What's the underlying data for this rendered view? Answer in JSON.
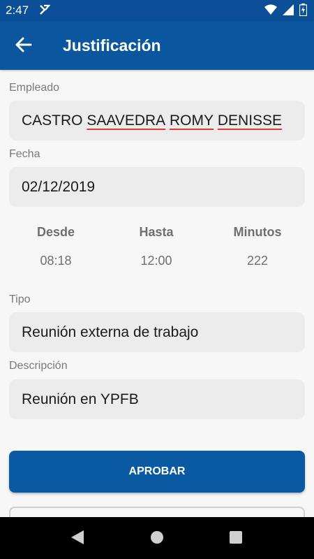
{
  "status_bar": {
    "time": "2:47"
  },
  "app_bar": {
    "title": "Justificación"
  },
  "form": {
    "empleado": {
      "label": "Empleado",
      "value_prefix": "CASTRO ",
      "value_w1": "SAAVEDRA",
      "value_w2": "ROMY",
      "value_w3": "DENISSE"
    },
    "fecha": {
      "label": "Fecha",
      "value": "02/12/2019"
    },
    "horario": {
      "desde": {
        "label": "Desde",
        "value": "08:18"
      },
      "hasta": {
        "label": "Hasta",
        "value": "12:00"
      },
      "minutos": {
        "label": "Minutos",
        "value": "222"
      }
    },
    "tipo": {
      "label": "Tipo",
      "value": "Reunión externa de trabajo"
    },
    "descripcion": {
      "label": "Descripción",
      "value": "Reunión en YPFB"
    }
  },
  "actions": {
    "aprobar_label": "APROBAR"
  },
  "colors": {
    "primary": "#0a579f",
    "status_bar": "#0a4f97",
    "field_bg": "#ececec",
    "spell_underline": "#e53935"
  }
}
